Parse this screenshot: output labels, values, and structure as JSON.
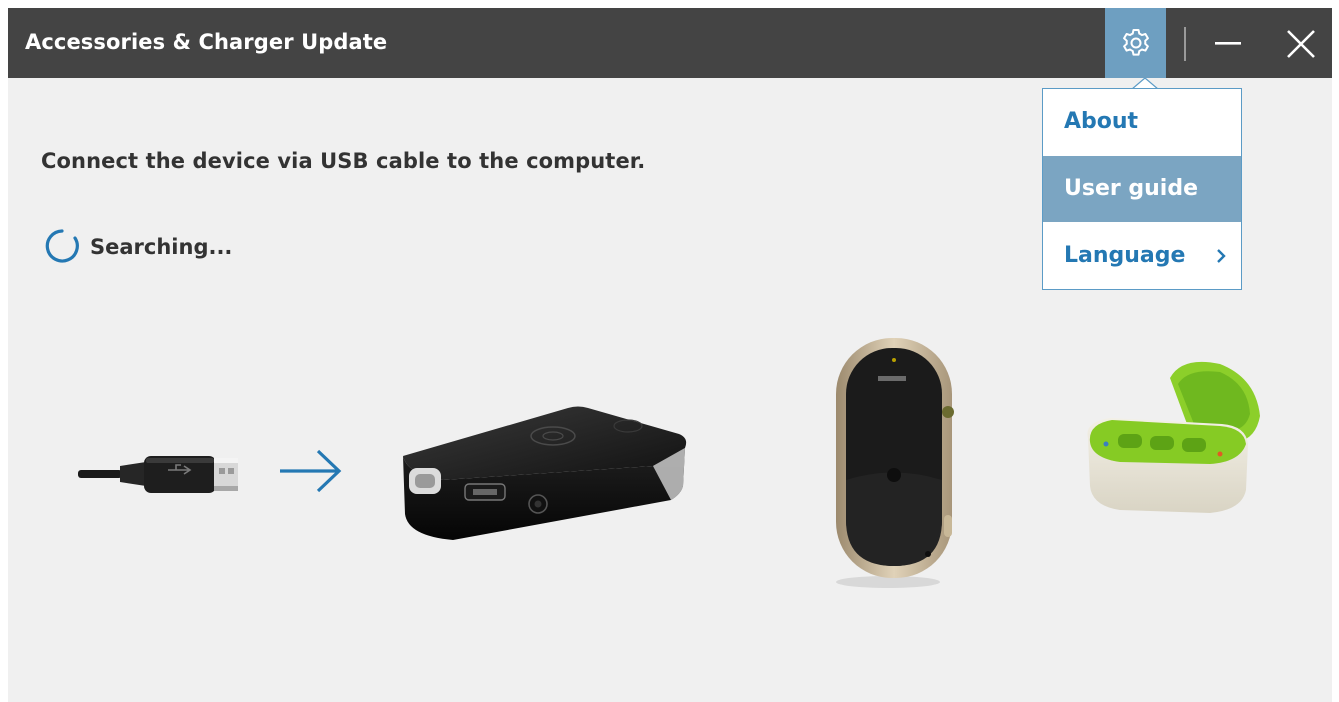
{
  "window": {
    "title": "Accessories & Charger Update",
    "controls": {
      "settings_icon": "gear-icon",
      "minimize_icon": "minimize-icon",
      "close_icon": "close-icon"
    }
  },
  "main": {
    "instruction": "Connect the device via USB cable to the computer.",
    "status": "Searching..."
  },
  "settings_menu": {
    "items": [
      {
        "label": "About",
        "selected": false
      },
      {
        "label": "User guide",
        "selected": true
      },
      {
        "label": "Language",
        "selected": false,
        "has_submenu": true
      }
    ]
  },
  "colors": {
    "titlebar": "#444444",
    "accent": "#2478b3",
    "menu_selected": "#7ba5c2",
    "background": "#f0f0f0"
  },
  "illustrations": [
    "usb-cable",
    "arrow-icon",
    "tv-connector-box",
    "remote-control",
    "charger-case"
  ]
}
